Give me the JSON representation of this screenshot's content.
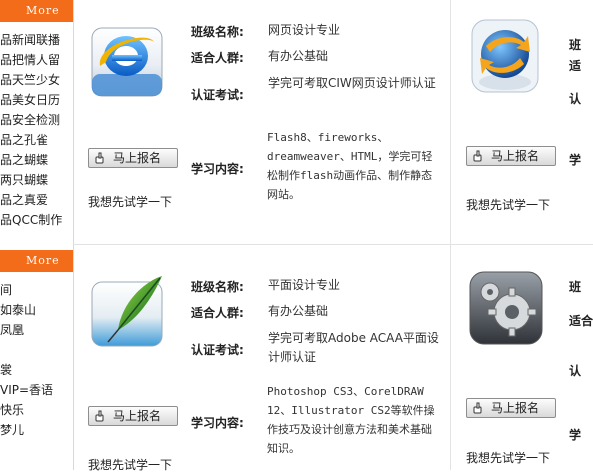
{
  "left": {
    "more_label": "More",
    "list1": [
      "品新闻联播",
      "品把情人留",
      "品天竺少女",
      "品美女日历",
      "品安全检测",
      "品之孔雀",
      "品之蝴蝶",
      "两只蝴蝶",
      "品之真爱",
      "品QCC制作"
    ],
    "list2": [
      "间",
      "如泰山",
      "凤凰",
      "",
      "裳",
      "VIP=香语",
      "快乐",
      "梦儿"
    ]
  },
  "labels": {
    "class_name": "班级名称:",
    "audience": "适合人群:",
    "exam": "认证考试:",
    "content": "学习内容:"
  },
  "signup_label": "马上报名",
  "try_label": "我想先试学一下",
  "courses": [
    {
      "icon": "ie-browser-icon",
      "class_name": "网页设计专业",
      "audience": "有办公基础",
      "exam": "学完可考取CIW网页设计师认证",
      "content": "Flash8、fireworks、dreamweaver、HTML，学完可轻松制作flash动画作品、制作静态网站。"
    },
    {
      "icon": "feather-icon",
      "class_name": "平面设计专业",
      "audience": "有办公基础",
      "exam": "学完可考取Adobe ACAA平面设计师认证",
      "content": "Photoshop CS3、CorelDRAW 12、Illustrator CS2等软件操作技巧及设计创意方法和美术基础知识。"
    },
    {
      "icon": "globe-arrow-icon",
      "class_name": "班",
      "audience": "适",
      "exam": "认",
      "content": "学"
    },
    {
      "icon": "gears-icon",
      "class_name": "班",
      "audience": "适合",
      "exam": "认",
      "content": "学"
    }
  ]
}
